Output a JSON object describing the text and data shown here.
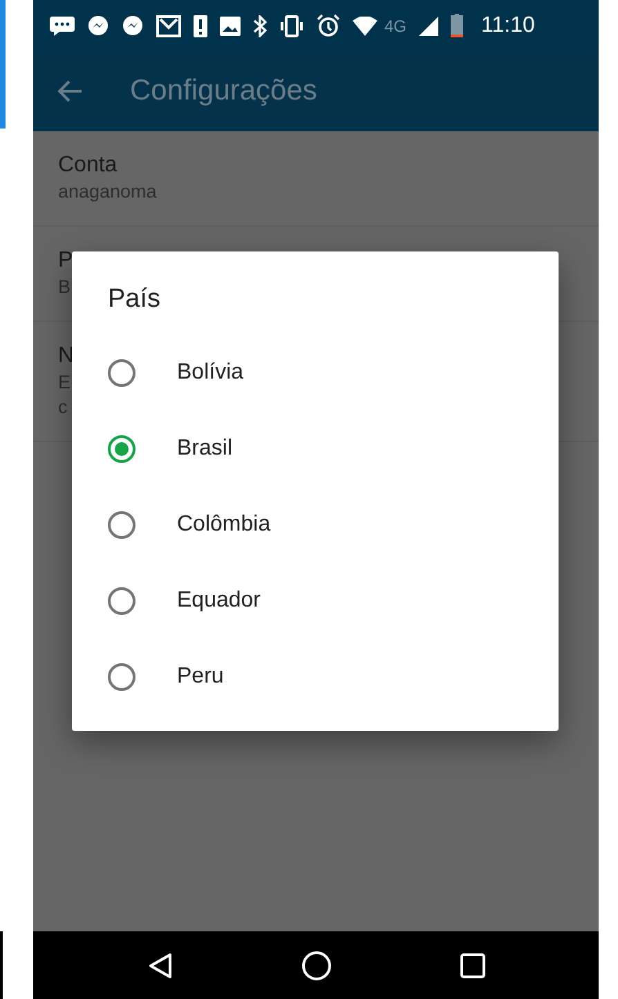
{
  "status_bar": {
    "network": "4G",
    "time": "11:10"
  },
  "app_bar": {
    "title": "Configurações"
  },
  "settings": [
    {
      "title": "Conta",
      "subtitle": "anaganoma"
    },
    {
      "title": "P",
      "subtitle": "B"
    },
    {
      "title": "N",
      "subtitle_lines": [
        "E",
        "c"
      ]
    }
  ],
  "dialog": {
    "title": "País",
    "options": [
      {
        "label": "Bolívia",
        "selected": false
      },
      {
        "label": "Brasil",
        "selected": true
      },
      {
        "label": "Colômbia",
        "selected": false
      },
      {
        "label": "Equador",
        "selected": false
      },
      {
        "label": "Peru",
        "selected": false
      }
    ]
  }
}
